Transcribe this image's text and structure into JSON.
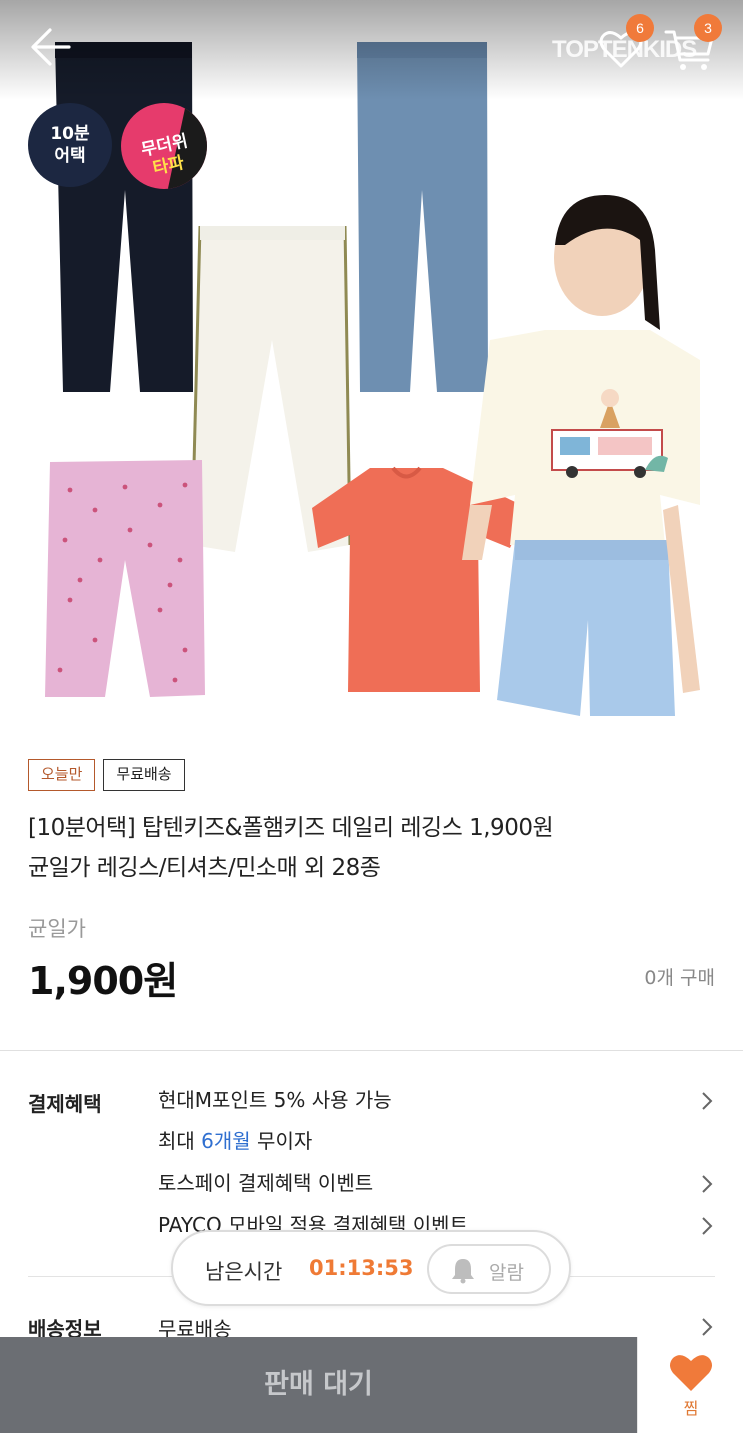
{
  "header": {
    "brand": "TOPTENKIDS",
    "wish_count": "6",
    "cart_count": "3"
  },
  "stickers": {
    "ten_minute_line1": "10분",
    "ten_minute_line2": "어택",
    "heat_line1": "무더위",
    "heat_line2": "타파"
  },
  "product": {
    "tags": [
      "오늘만",
      "무료배송"
    ],
    "title_line1": "[10분어택] 탑텐키즈&폴햄키즈 데일리 레깅스 1,900원",
    "title_line2": "균일가 레깅스/티셔츠/민소매 외 28종",
    "price_label": "균일가",
    "price": "1,900원",
    "purchase_count": "0개 구매"
  },
  "benefits": {
    "label": "결제혜택",
    "items": [
      "현대M포인트 5% 사용 가능",
      "토스페이 결제혜택 이벤트",
      "PAYCO 모바일 적용 결제혜택 이벤트"
    ],
    "installment_prefix": "최대 ",
    "installment_highlight": "6개월",
    "installment_suffix": " 무이자"
  },
  "shipping": {
    "label": "배송정보",
    "value": "무료배송"
  },
  "timer": {
    "label": "남은시간",
    "value": "01:13:53",
    "alarm_label": "알람"
  },
  "bottom": {
    "sale_wait_label": "판매 대기",
    "zzim_label": "찜"
  },
  "colors": {
    "accent_orange": "#ef7a35",
    "link_blue": "#2f6fd0",
    "disabled_bar": "#6b6e73"
  }
}
